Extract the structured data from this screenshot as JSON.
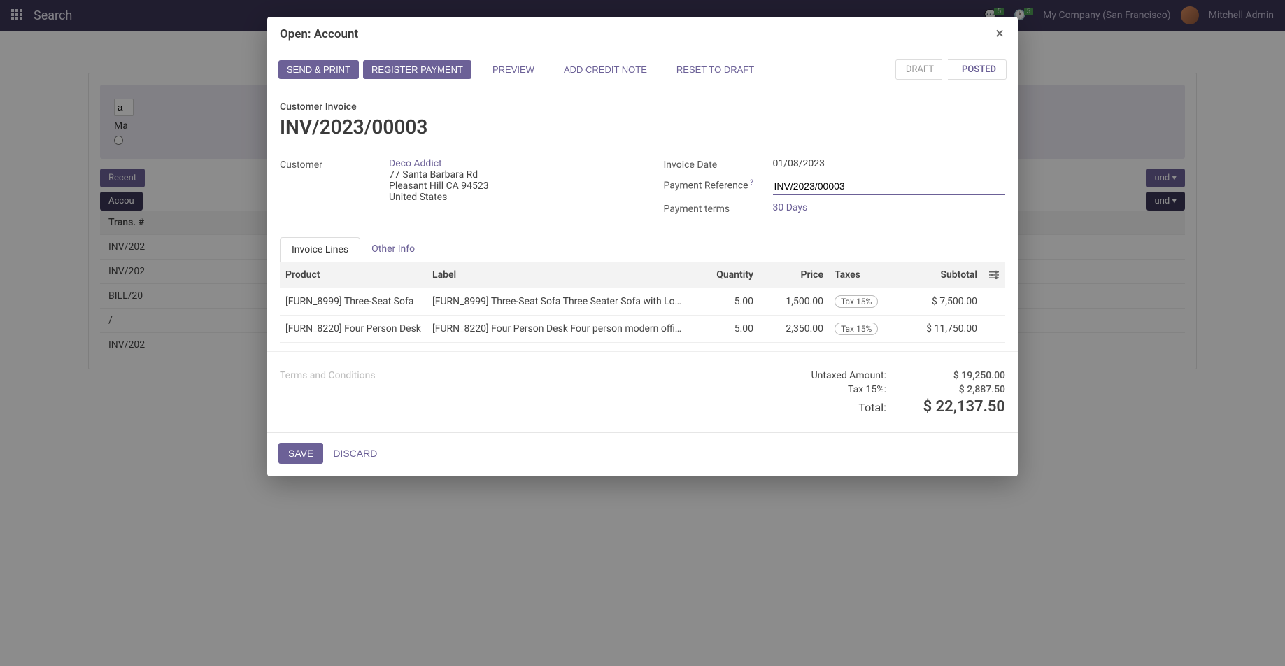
{
  "navbar": {
    "title": "Search",
    "badge1": "5",
    "badge2": "5",
    "company": "My Company (San Francisco)",
    "user": "Mitchell Admin"
  },
  "bg": {
    "input_prefix": "a",
    "ma_label": "Ma",
    "recent_btn": "Recent",
    "accou_btn": "Accou",
    "und_btn1": "und",
    "und_btn2": "und",
    "trans_head": "Trans. #",
    "rows": [
      "INV/202",
      "INV/202",
      "BILL/20",
      "/",
      "INV/202"
    ]
  },
  "modal": {
    "title": "Open: Account",
    "actions": {
      "send_print": "SEND & PRINT",
      "register_payment": "REGISTER PAYMENT",
      "preview": "PREVIEW",
      "add_credit_note": "ADD CREDIT NOTE",
      "reset_draft": "RESET TO DRAFT"
    },
    "status": {
      "draft": "DRAFT",
      "posted": "POSTED"
    },
    "doc_type": "Customer Invoice",
    "doc_number": "INV/2023/00003",
    "left": {
      "customer_label": "Customer",
      "customer_name": "Deco Addict",
      "addr1": "77 Santa Barbara Rd",
      "addr2": "Pleasant Hill CA 94523",
      "addr3": "United States"
    },
    "right": {
      "invoice_date_label": "Invoice Date",
      "invoice_date": "01/08/2023",
      "payment_ref_label": "Payment Reference",
      "payment_ref": "INV/2023/00003",
      "payment_terms_label": "Payment terms",
      "payment_terms": "30 Days"
    },
    "tabs": {
      "lines": "Invoice Lines",
      "other": "Other Info"
    },
    "table": {
      "headers": {
        "product": "Product",
        "label": "Label",
        "quantity": "Quantity",
        "price": "Price",
        "taxes": "Taxes",
        "subtotal": "Subtotal"
      },
      "rows": [
        {
          "product": "[FURN_8999] Three-Seat Sofa",
          "label": "[FURN_8999] Three-Seat Sofa Three Seater Sofa with Lo…",
          "quantity": "5.00",
          "price": "1,500.00",
          "tax": "Tax 15%",
          "subtotal": "$ 7,500.00"
        },
        {
          "product": "[FURN_8220] Four Person Desk",
          "label": "[FURN_8220] Four Person Desk Four person modern offi…",
          "quantity": "5.00",
          "price": "2,350.00",
          "tax": "Tax 15%",
          "subtotal": "$ 11,750.00"
        }
      ]
    },
    "terms_placeholder": "Terms and Conditions",
    "totals": {
      "untaxed_label": "Untaxed Amount:",
      "untaxed": "$ 19,250.00",
      "tax_label": "Tax 15%:",
      "tax": "$ 2,887.50",
      "total_label": "Total:",
      "total": "$ 22,137.50"
    },
    "footer": {
      "save": "SAVE",
      "discard": "DISCARD"
    }
  }
}
